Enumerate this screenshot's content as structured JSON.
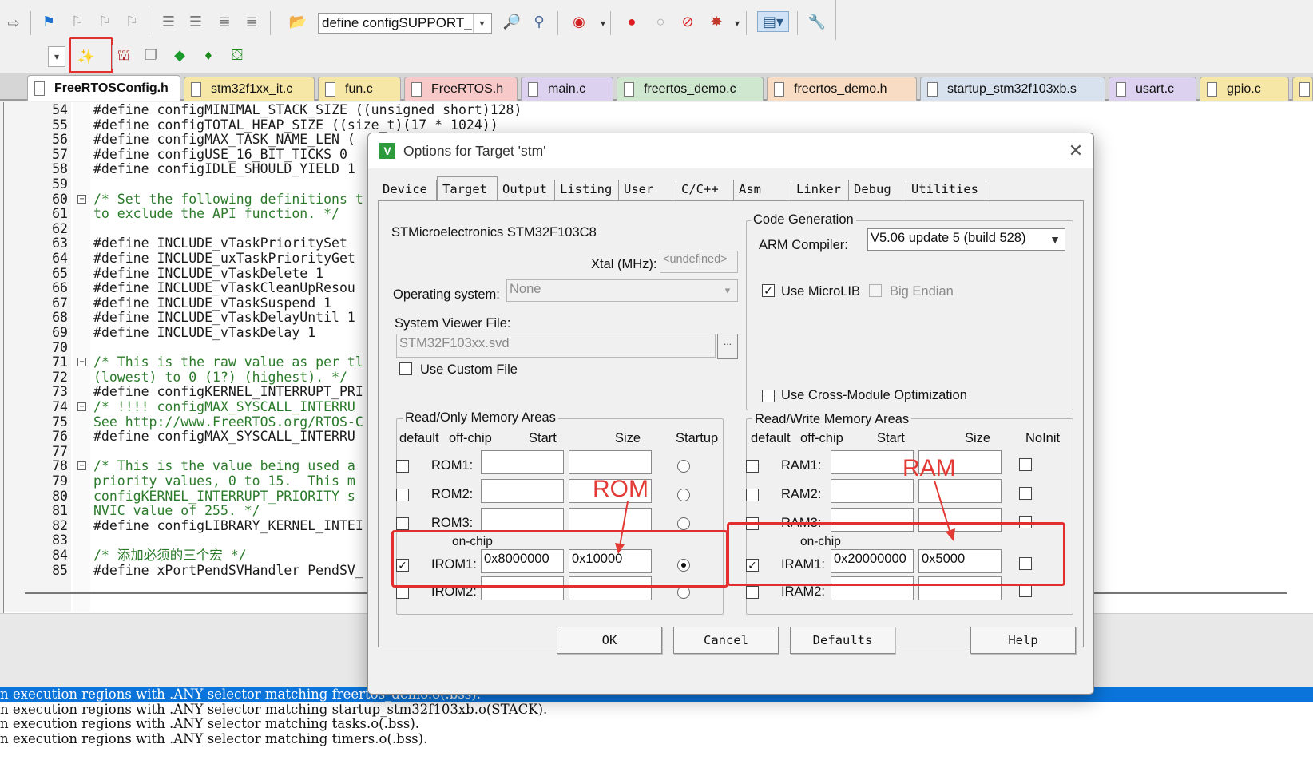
{
  "toolbar": {
    "define_combo": "define configSUPPORT_D"
  },
  "file_tabs": [
    {
      "label": "FreeRTOSConfig.h",
      "color": "#ffffff",
      "active": true
    },
    {
      "label": "stm32f1xx_it.c",
      "color": "#f6e7a6",
      "active": false
    },
    {
      "label": "fun.c",
      "color": "#f6e7a6",
      "active": false
    },
    {
      "label": "FreeRTOS.h",
      "color": "#f7c9c9",
      "active": false
    },
    {
      "label": "main.c",
      "color": "#dcd2ef",
      "active": false
    },
    {
      "label": "freertos_demo.c",
      "color": "#cfe7cf",
      "active": false
    },
    {
      "label": "freertos_demo.h",
      "color": "#f8dcc3",
      "active": false
    },
    {
      "label": "startup_stm32f103xb.s",
      "color": "#d8e2ef",
      "active": false
    },
    {
      "label": "usart.c",
      "color": "#dcd2ef",
      "active": false
    },
    {
      "label": "gpio.c",
      "color": "#f6e7a6",
      "active": false
    }
  ],
  "code_lines": [
    {
      "num": "54",
      "text": "#define configMINIMAL_STACK_SIZE ((unsigned short)128)",
      "fold": ""
    },
    {
      "num": "55",
      "text": "#define configTOTAL_HEAP_SIZE ((size_t)(17 * 1024))",
      "fold": ""
    },
    {
      "num": "56",
      "text": "#define configMAX_TASK_NAME_LEN (",
      "fold": ""
    },
    {
      "num": "57",
      "text": "#define configUSE_16_BIT_TICKS 0",
      "fold": ""
    },
    {
      "num": "58",
      "text": "#define configIDLE_SHOULD_YIELD 1",
      "fold": ""
    },
    {
      "num": "59",
      "text": "",
      "fold": ""
    },
    {
      "num": "60",
      "text": "/* Set the following definitions t",
      "fold": "−"
    },
    {
      "num": "61",
      "text": "to exclude the API function. */",
      "fold": ""
    },
    {
      "num": "62",
      "text": "",
      "fold": ""
    },
    {
      "num": "63",
      "text": "#define INCLUDE_vTaskPrioritySet",
      "fold": ""
    },
    {
      "num": "64",
      "text": "#define INCLUDE_uxTaskPriorityGet",
      "fold": ""
    },
    {
      "num": "65",
      "text": "#define INCLUDE_vTaskDelete 1",
      "fold": ""
    },
    {
      "num": "66",
      "text": "#define INCLUDE_vTaskCleanUpResou",
      "fold": ""
    },
    {
      "num": "67",
      "text": "#define INCLUDE_vTaskSuspend 1",
      "fold": ""
    },
    {
      "num": "68",
      "text": "#define INCLUDE_vTaskDelayUntil 1",
      "fold": ""
    },
    {
      "num": "69",
      "text": "#define INCLUDE_vTaskDelay 1",
      "fold": ""
    },
    {
      "num": "70",
      "text": "",
      "fold": ""
    },
    {
      "num": "71",
      "text": "/* This is the raw value as per tl",
      "fold": "−"
    },
    {
      "num": "72",
      "text": "(lowest) to 0 (1?) (highest). */",
      "fold": ""
    },
    {
      "num": "73",
      "text": "#define configKERNEL_INTERRUPT_PRI",
      "fold": ""
    },
    {
      "num": "74",
      "text": "/* !!!! configMAX_SYSCALL_INTERRU",
      "fold": "−"
    },
    {
      "num": "75",
      "text": "See http://www.FreeRTOS.org/RTOS-C",
      "fold": ""
    },
    {
      "num": "76",
      "text": "#define configMAX_SYSCALL_INTERRU",
      "fold": ""
    },
    {
      "num": "77",
      "text": "",
      "fold": ""
    },
    {
      "num": "78",
      "text": "/* This is the value being used a",
      "fold": "−"
    },
    {
      "num": "79",
      "text": "priority values, 0 to 15.  This m",
      "fold": ""
    },
    {
      "num": "80",
      "text": "configKERNEL_INTERRUPT_PRIORITY s",
      "fold": ""
    },
    {
      "num": "81",
      "text": "NVIC value of 255. */",
      "fold": ""
    },
    {
      "num": "82",
      "text": "#define configLIBRARY_KERNEL_INTEI",
      "fold": ""
    },
    {
      "num": "83",
      "text": "",
      "fold": ""
    },
    {
      "num": "84",
      "text": "/* 添加必须的三个宏 */",
      "fold": ""
    },
    {
      "num": "85",
      "text": "#define xPortPendSVHandler PendSV_",
      "fold": ""
    }
  ],
  "output_lines": [
    {
      "text": "n execution regions with .ANY selector matching freertos_demo.o(.bss).",
      "selected": true
    },
    {
      "text": "n execution regions with .ANY selector matching startup_stm32f103xb.o(STACK).",
      "selected": false
    },
    {
      "text": "n execution regions with .ANY selector matching tasks.o(.bss).",
      "selected": false
    },
    {
      "text": "n execution regions with .ANY selector matching timers.o(.bss).",
      "selected": false
    }
  ],
  "dialog": {
    "title": "Options for Target 'stm'",
    "tabs": [
      "Device",
      "Target",
      "Output",
      "Listing",
      "User",
      "C/C++",
      "Asm",
      "Linker",
      "Debug",
      "Utilities"
    ],
    "active_tab": "Target",
    "device_name": "STMicroelectronics STM32F103C8",
    "xtal_label": "Xtal (MHz):",
    "xtal_value": "<undefined>",
    "os_label": "Operating system:",
    "os_value": "None",
    "svd_label": "System Viewer File:",
    "svd_value": "STM32F103xx.svd",
    "svd_browse": "...",
    "use_custom_file": "Use Custom File",
    "code_gen": {
      "title": "Code Generation",
      "compiler_label": "ARM Compiler:",
      "compiler_value": "V5.06 update 5 (build 528)",
      "use_microlib": "Use MicroLIB",
      "big_endian": "Big Endian",
      "cross_module": "Use Cross-Module Optimization"
    },
    "rom": {
      "title": "Read/Only Memory Areas",
      "headers": {
        "default": "default",
        "offchip": "off-chip",
        "start": "Start",
        "size": "Size",
        "startup": "Startup"
      },
      "onchip_label": "on-chip",
      "rows": [
        {
          "name": "ROM1:",
          "start": "",
          "size": "",
          "default": false,
          "startup": false
        },
        {
          "name": "ROM2:",
          "start": "",
          "size": "",
          "default": false,
          "startup": false
        },
        {
          "name": "ROM3:",
          "start": "",
          "size": "",
          "default": false,
          "startup": false
        },
        {
          "name": "IROM1:",
          "start": "0x8000000",
          "size": "0x10000",
          "default": true,
          "startup": true
        },
        {
          "name": "IROM2:",
          "start": "",
          "size": "",
          "default": false,
          "startup": false
        }
      ]
    },
    "ram": {
      "title": "Read/Write Memory Areas",
      "headers": {
        "default": "default",
        "offchip": "off-chip",
        "start": "Start",
        "size": "Size",
        "noinit": "NoInit"
      },
      "onchip_label": "on-chip",
      "rows": [
        {
          "name": "RAM1:",
          "start": "",
          "size": "",
          "default": false
        },
        {
          "name": "RAM2:",
          "start": "",
          "size": "",
          "default": false
        },
        {
          "name": "RAM3:",
          "start": "",
          "size": "",
          "default": false
        },
        {
          "name": "IRAM1:",
          "start": "0x20000000",
          "size": "0x5000",
          "default": true
        },
        {
          "name": "IRAM2:",
          "start": "",
          "size": "",
          "default": false
        }
      ]
    },
    "annotations": {
      "rom": "ROM",
      "ram": "RAM"
    },
    "buttons": {
      "ok": "OK",
      "cancel": "Cancel",
      "defaults": "Defaults",
      "help": "Help"
    }
  },
  "colors": {
    "highlight_red": "#e22e2e",
    "selection_blue": "#0a74da"
  }
}
